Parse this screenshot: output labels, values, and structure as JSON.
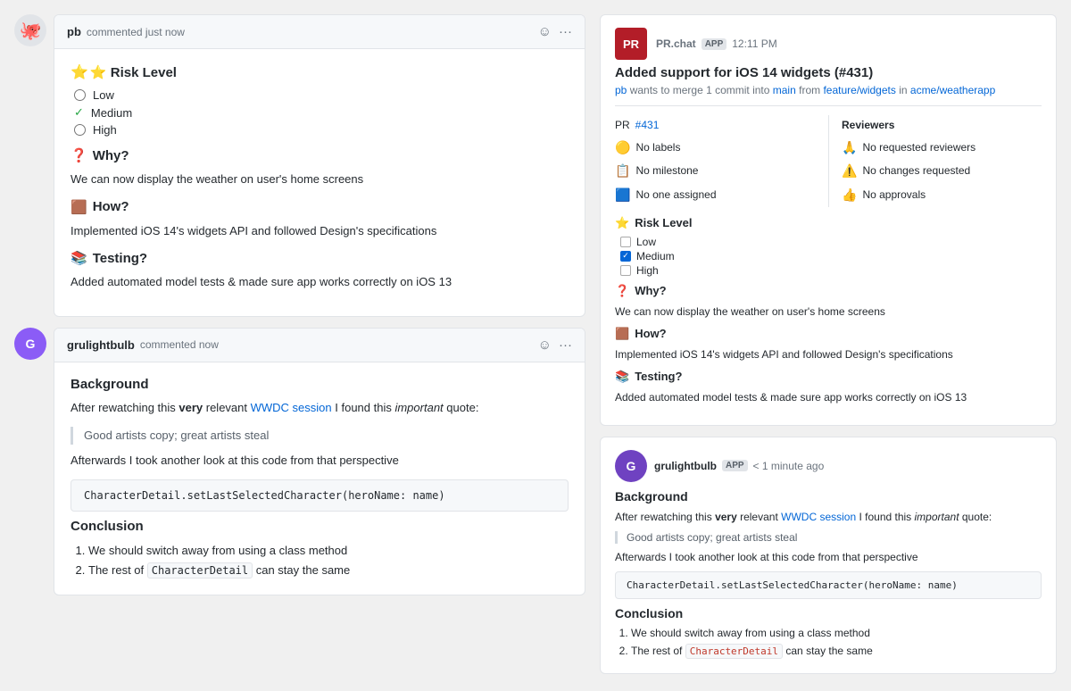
{
  "left": {
    "comment1": {
      "username": "pb",
      "meta": "commented just now",
      "risk_level_title": "⭐ Risk Level",
      "risk_options": [
        "Low",
        "Medium",
        "High"
      ],
      "risk_checked": "Medium",
      "why_title": "❓ Why?",
      "why_content": "We can now display the weather on user's home screens",
      "how_title": "🟫 How?",
      "how_content": "Implemented iOS 14's widgets API and followed Design's specifications",
      "testing_title": "📚 Testing?",
      "testing_content": "Added automated model tests & made sure app works correctly on iOS 13"
    },
    "comment2": {
      "username": "grulightbulb",
      "meta": "commented now",
      "background_title": "Background",
      "background_intro": "After rewatching this ",
      "background_bold": "very",
      "background_mid": " relevant ",
      "background_link": "WWDC session",
      "background_end": " I found this ",
      "background_italic": "important",
      "background_end2": " quote:",
      "blockquote": "Good artists copy; great artists steal",
      "background_after": "Afterwards I took another look at this code from that perspective",
      "code": "CharacterDetail.setLastSelectedCharacter(heroName: name)",
      "conclusion_title": "Conclusion",
      "conclusion_items": [
        "We should switch away from using a class method",
        "The rest of CharacterDetail can stay the same"
      ]
    }
  },
  "right": {
    "pr_message": {
      "bot_initials": "PR",
      "app_name": "PR.chat",
      "app_badge": "APP",
      "time": "12:11 PM",
      "title": "Added support for iOS 14 widgets (#431)",
      "subtitle_user": "pb",
      "subtitle_mid": " wants to merge 1 commit into ",
      "subtitle_branch_main": "main",
      "subtitle_from": " from ",
      "subtitle_branch_feature": "feature/widgets",
      "subtitle_in": " in ",
      "subtitle_repo": "acme/weatherapp",
      "pr_num": "#431",
      "details_left": [
        {
          "emoji": "🟡",
          "text": "No labels"
        },
        {
          "emoji": "📋",
          "text": "No milestone"
        },
        {
          "emoji": "🟦",
          "text": "No one assigned"
        }
      ],
      "reviewers_title": "Reviewers",
      "reviewers_items": [
        {
          "emoji": "🙏",
          "text": "No requested reviewers"
        },
        {
          "emoji": "⚠️",
          "text": "No changes requested"
        },
        {
          "emoji": "👍",
          "text": "No approvals"
        }
      ],
      "risk_level_title": "⭐ Risk Level",
      "risk_options": [
        {
          "label": "Low",
          "checked": false
        },
        {
          "label": "Medium",
          "checked": true
        },
        {
          "label": "High",
          "checked": false
        }
      ],
      "why_title": "❓ Why?",
      "why_content": "We can now display the weather on user's home screens",
      "how_title": "🟫 How?",
      "how_content": "Implemented iOS 14's widgets API and followed Design's specifications",
      "testing_title": "📚 Testing?",
      "testing_content": "Added automated model tests & made sure app works correctly on iOS 13"
    },
    "grulightbulb_message": {
      "username": "grulightbulb",
      "app_badge": "APP",
      "time": "< 1 minute ago",
      "background_title": "Background",
      "background_intro": "After rewatching this ",
      "background_bold": "very",
      "background_mid": " relevant ",
      "background_link": "WWDC session",
      "background_end": " I found this ",
      "background_italic": "important",
      "background_end2": " quote:",
      "blockquote": "Good artists copy; great artists steal",
      "background_after": "Afterwards I took another look at this code from that perspective",
      "code": "CharacterDetail.setLastSelectedCharacter(heroName: name)",
      "conclusion_title": "Conclusion",
      "conclusion_items": [
        "We should switch away from using a class method",
        "The rest of CharacterDetail can stay the same"
      ]
    }
  }
}
